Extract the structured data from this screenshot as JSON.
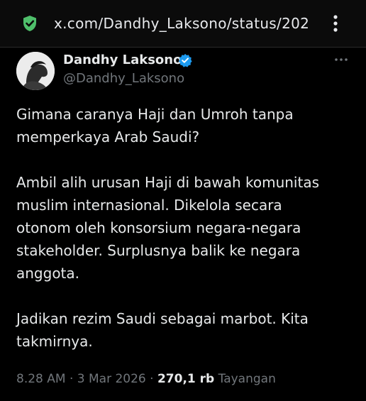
{
  "browser": {
    "url": "x.com/Dandhy_Laksono/status/202",
    "security_icon": "shield-check-icon",
    "menu_icon": "kebab-menu-icon",
    "security_color": "#4fbf6b"
  },
  "tweet": {
    "author_name": "Dandhy Laksono",
    "handle": "@Dandhy_Laksono",
    "verified_icon": "verified-badge-icon",
    "verified_color": "#1d9bf0",
    "more_icon": "more-options-icon",
    "paragraphs": [
      [
        "Gimana caranya Haji dan Umroh tanpa",
        "memperkaya Arab Saudi?"
      ],
      [
        "Ambil alih urusan Haji di bawah komunitas",
        "muslim internasional. Dikelola secara",
        "otonom oleh konsorsium negara-negara",
        "stakeholder. Surplusnya balik ke negara",
        "anggota."
      ],
      [
        "Jadikan rezim Saudi sebagai marbot. Kita",
        "takmirnya."
      ]
    ],
    "time": "8.28 AM",
    "date": "3 Mar 2026",
    "separator": "·",
    "views_count": "270,1 rb",
    "views_label": "Tayangan"
  }
}
